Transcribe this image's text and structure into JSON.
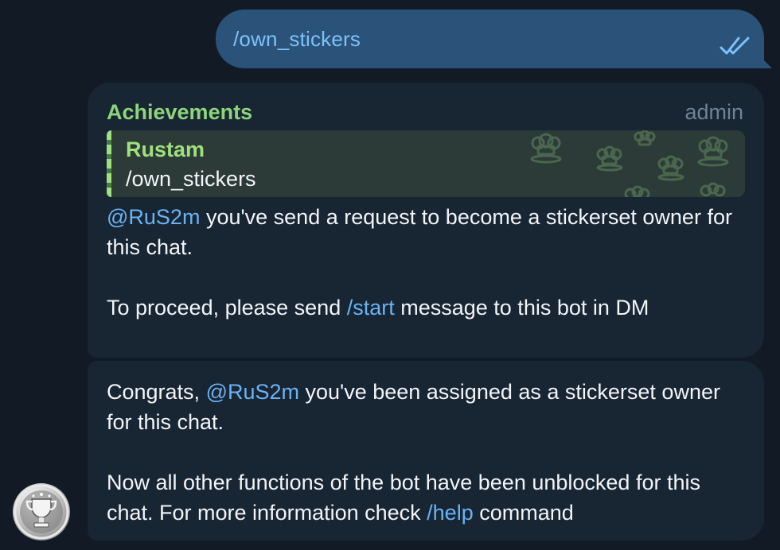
{
  "outgoing": {
    "text": "/own_stickers",
    "status_icon": "double-check-icon"
  },
  "messages": [
    {
      "sender": "Achievements",
      "role": "admin",
      "reply": {
        "name": "Rustam",
        "text": "/own_stickers"
      },
      "p1_mention": "@RuS2m",
      "p1_rest": " you've send a request to become a stickerset owner for this chat.",
      "p2_before": "To proceed, please send ",
      "p2_link": "/start",
      "p2_after": " message to this bot in DM"
    },
    {
      "p1_before": "Congrats, ",
      "p1_mention": "@RuS2m",
      "p1_rest": " you've been assigned as a stickerset owner for this chat.",
      "p2_before": "Now all other functions of the bot have been unblocked for this chat. For more information check ",
      "p2_link": "/help",
      "p2_after": " command"
    }
  ],
  "bot_avatar_icon": "trophy-icon",
  "colors": {
    "outgoing_bubble": "#2b5278",
    "incoming_bubble": "#182533",
    "link": "#6ab3f3",
    "sender": "#8ed47b"
  }
}
